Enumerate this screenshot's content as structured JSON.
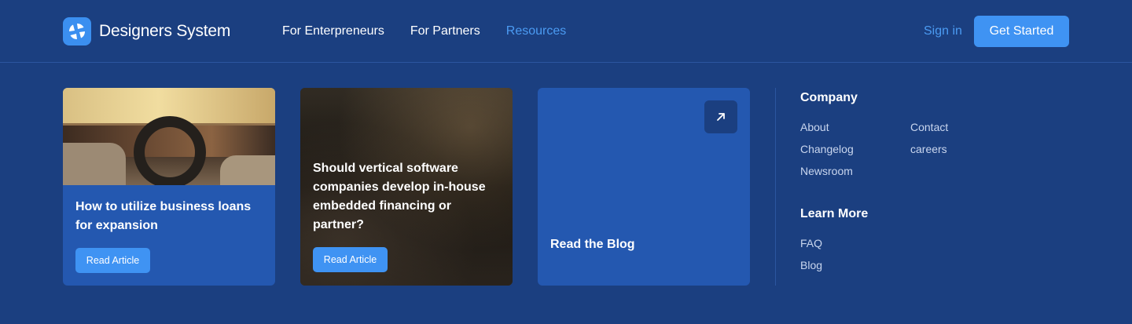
{
  "brand": {
    "name": "Designers System"
  },
  "nav": {
    "items": [
      {
        "label": "For Enterpreneurs"
      },
      {
        "label": "For Partners"
      },
      {
        "label": "Resources"
      }
    ]
  },
  "auth": {
    "signin_label": "Sign in",
    "get_started_label": "Get Started"
  },
  "cards": [
    {
      "title": "How to utilize business loans for expansion",
      "button": "Read Article"
    },
    {
      "title": "Should vertical software companies develop in-house embedded financing or partner?",
      "button": "Read Article"
    },
    {
      "title": "Read the Blog"
    }
  ],
  "company": {
    "title": "Company",
    "links": [
      "About",
      "Contact",
      "Changelog",
      "careers",
      "Newsroom"
    ]
  },
  "learn_more": {
    "title": "Learn More",
    "links": [
      "FAQ",
      "Blog"
    ]
  },
  "colors": {
    "background": "#1b3f80",
    "accent": "#3f93f3",
    "active_link": "#4b9bf2",
    "card": "#2458b0"
  }
}
